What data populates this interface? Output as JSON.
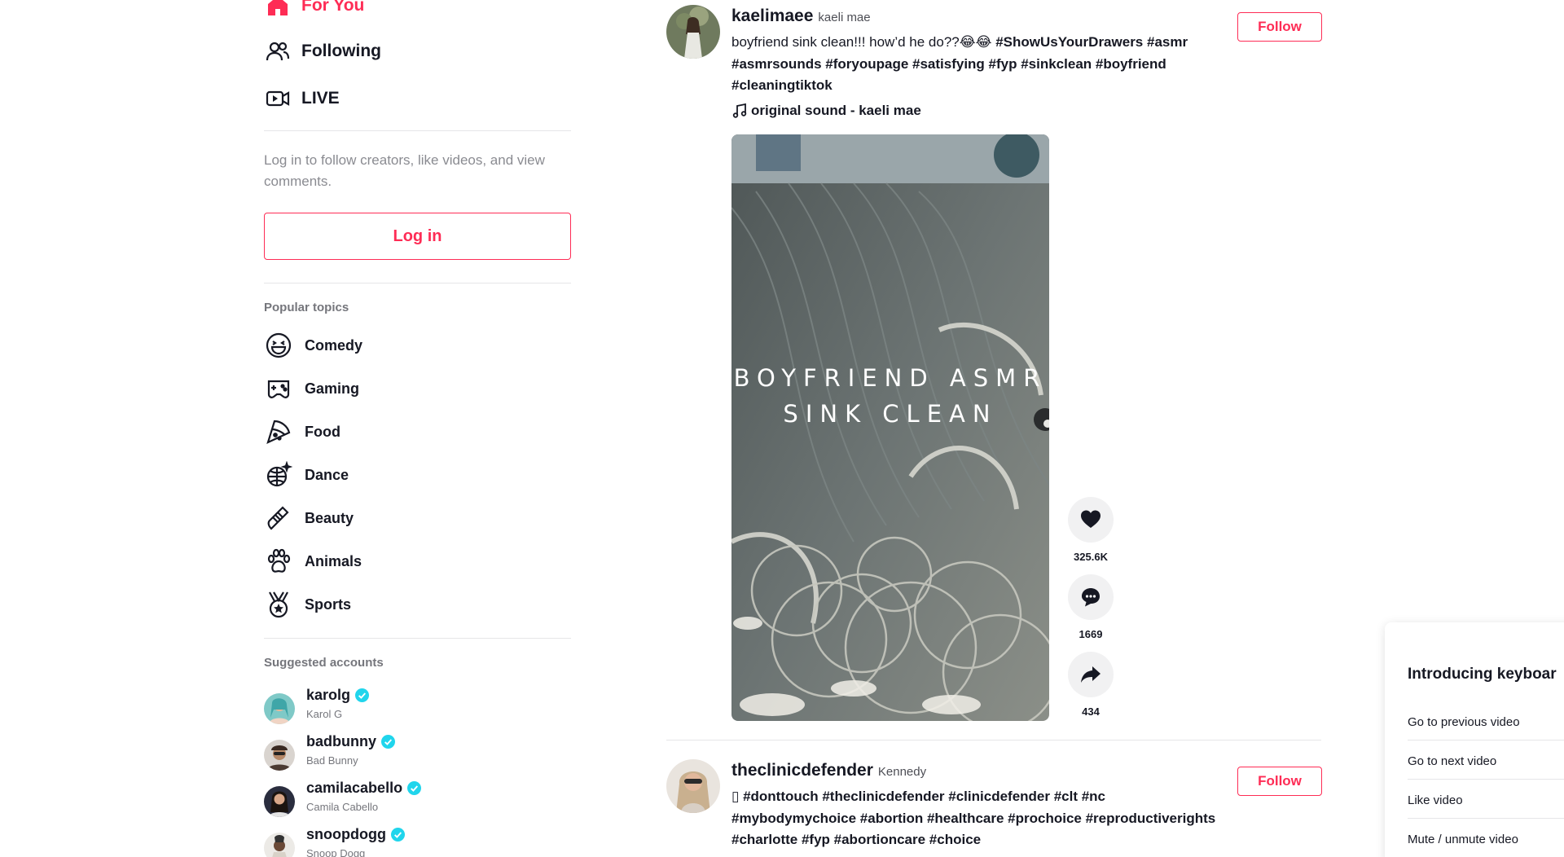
{
  "colors": {
    "brand": "#fe2c55",
    "muted": "#8a8b91",
    "verified": "#20d5ec"
  },
  "sidebar": {
    "nav": [
      {
        "label": "For You",
        "icon": "home-icon"
      },
      {
        "label": "Following",
        "icon": "following-icon"
      },
      {
        "label": "LIVE",
        "icon": "live-icon"
      }
    ],
    "login_hint": "Log in to follow creators, like videos, and view comments.",
    "login_label": "Log in",
    "popular_topics_title": "Popular topics",
    "topics": [
      {
        "label": "Comedy",
        "icon": "comedy-icon"
      },
      {
        "label": "Gaming",
        "icon": "gaming-icon"
      },
      {
        "label": "Food",
        "icon": "food-icon"
      },
      {
        "label": "Dance",
        "icon": "dance-icon"
      },
      {
        "label": "Beauty",
        "icon": "beauty-icon"
      },
      {
        "label": "Animals",
        "icon": "animals-icon"
      },
      {
        "label": "Sports",
        "icon": "sports-icon"
      }
    ],
    "suggested_title": "Suggested accounts",
    "accounts": [
      {
        "username": "karolg",
        "display_name": "Karol G",
        "verified": true
      },
      {
        "username": "badbunny",
        "display_name": "Bad Bunny",
        "verified": true
      },
      {
        "username": "camilacabello",
        "display_name": "Camila Cabello",
        "verified": true
      },
      {
        "username": "snoopdogg",
        "display_name": "Snoop Dogg",
        "verified": true
      }
    ]
  },
  "feed": {
    "posts": [
      {
        "username": "kaelimaee",
        "nickname": "kaeli mae",
        "follow_label": "Follow",
        "caption_text": "boyfriend sink clean!!! how’d he do??😂😂 ",
        "caption_tags": "#ShowUsYourDrawers #asmr #asmrsounds #foryoupage #satisfying #fyp #sinkclean #boyfriend #cleaningtiktok",
        "music": "original sound - kaeli mae",
        "video_overlay": "BOYFRIEND ASMR SINK CLEAN",
        "likes": "325.6K",
        "comments": "1669",
        "shares": "434"
      },
      {
        "username": "theclinicdefender",
        "nickname": "Kennedy",
        "follow_label": "Follow",
        "caption_text": "▯ ",
        "caption_tags": "#donttouch #theclinicdefender #clinicdefender #clt #nc #mybodymychoice #abortion #healthcare #prochoice #reproductiverights #charlotte #fyp #abortioncare #choice"
      }
    ]
  },
  "keyboard_panel": {
    "title": "Introducing keyboar",
    "shortcuts": [
      "Go to previous video",
      "Go to next video",
      "Like video",
      "Mute / unmute video"
    ]
  }
}
